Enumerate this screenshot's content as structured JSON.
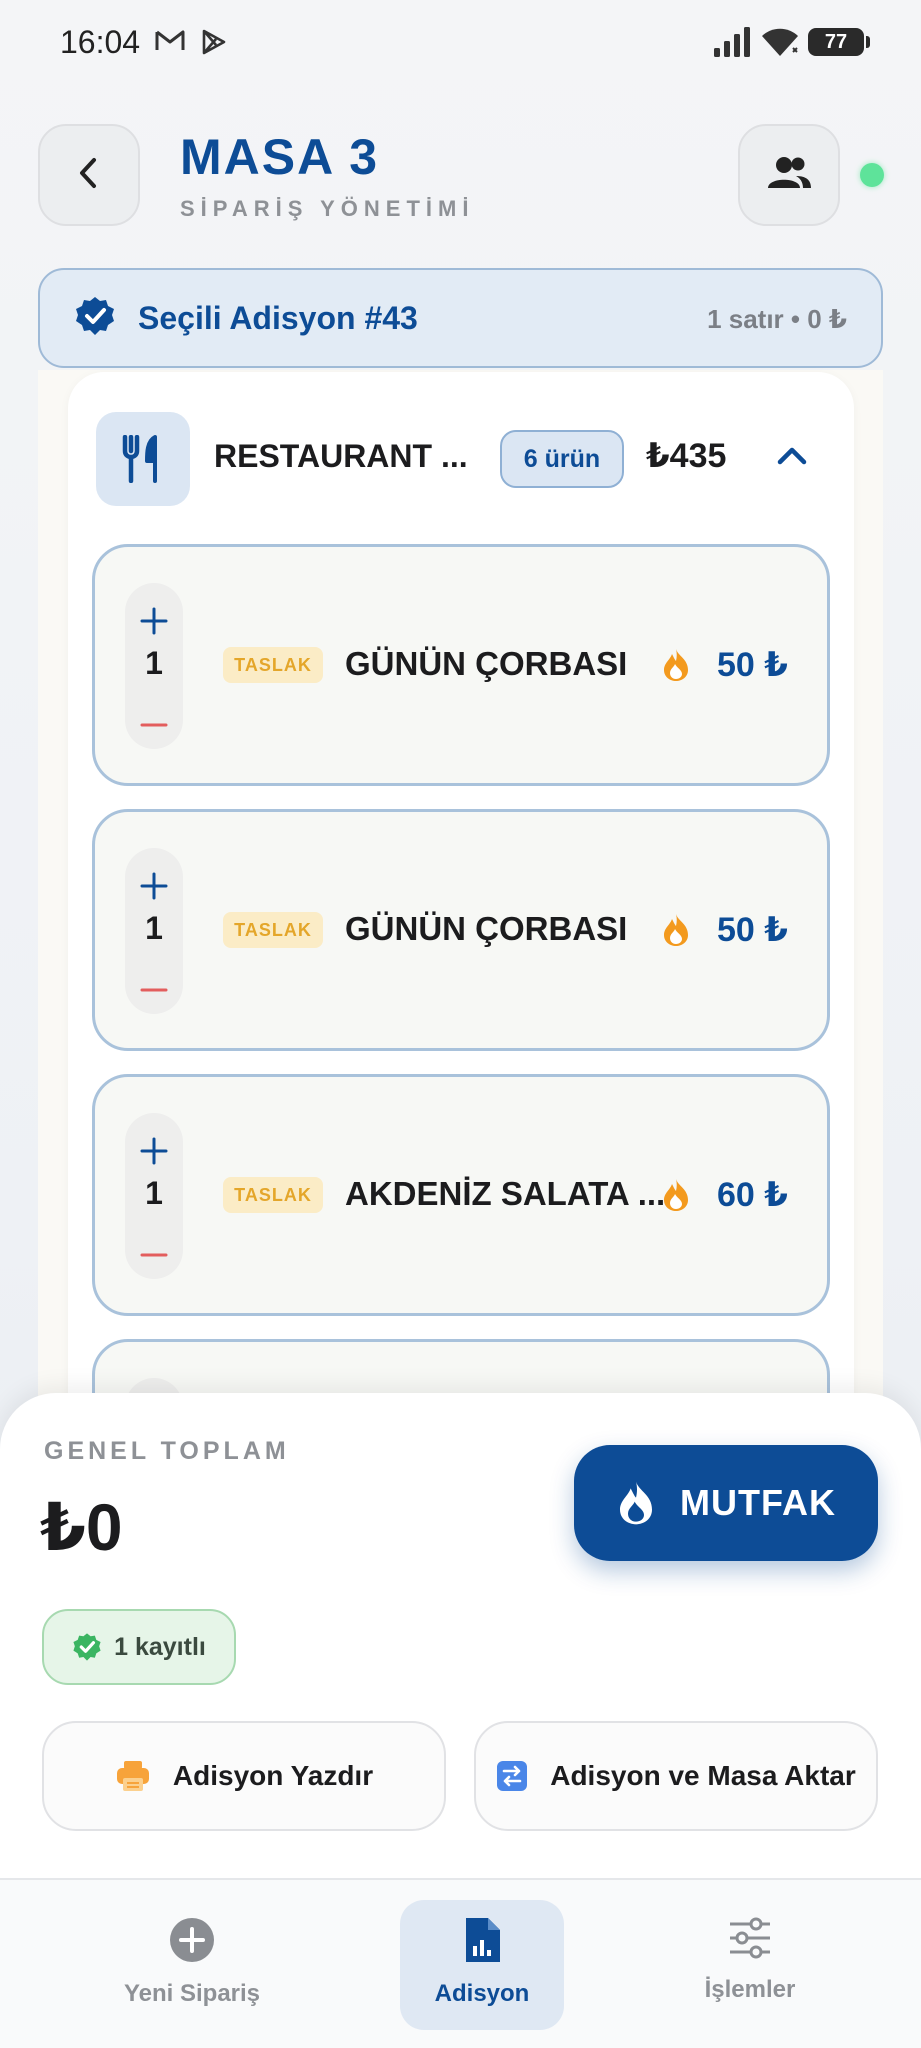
{
  "status_bar": {
    "time": "16:04",
    "icons": [
      "gmail-icon",
      "play-store-icon",
      "signal-icon",
      "wifi-icon"
    ],
    "battery": "77"
  },
  "header": {
    "title": "MASA 3",
    "subtitle": "SİPARİŞ YÖNETİMİ",
    "online_color": "#5ee39a"
  },
  "selected_check": {
    "title": "Seçili Adisyon #43",
    "meta": "1 satır • 0 ₺"
  },
  "group": {
    "name": "RESTAURANT ...",
    "count": "6 ürün",
    "total": "₺435"
  },
  "items": [
    {
      "qty": "1",
      "status": "TASLAK",
      "name": "GÜNÜN ÇORBASI",
      "price": "50 ₺"
    },
    {
      "qty": "1",
      "status": "TASLAK",
      "name": "GÜNÜN ÇORBASI",
      "price": "50 ₺"
    },
    {
      "qty": "1",
      "status": "TASLAK",
      "name": "AKDENİZ SALATA ...",
      "price": "60 ₺"
    }
  ],
  "summary": {
    "total_label": "GENEL TOPLAM",
    "total_value": "₺0",
    "kitchen_button": "MUTFAK",
    "saved_badge": "1 kayıtlı",
    "print_button": "Adisyon Yazdır",
    "transfer_button": "Adisyon ve Masa Aktar"
  },
  "nav": {
    "new_order": "Yeni Sipariş",
    "check": "Adisyon",
    "operations": "İşlemler"
  },
  "colors": {
    "brand": "#0d4c96",
    "draft_badge_bg": "#fbecc6",
    "draft_badge_text": "#e4a62a",
    "fire": "#f39a1e",
    "minus": "#e35d5d",
    "saved_green": "#3bb562"
  }
}
